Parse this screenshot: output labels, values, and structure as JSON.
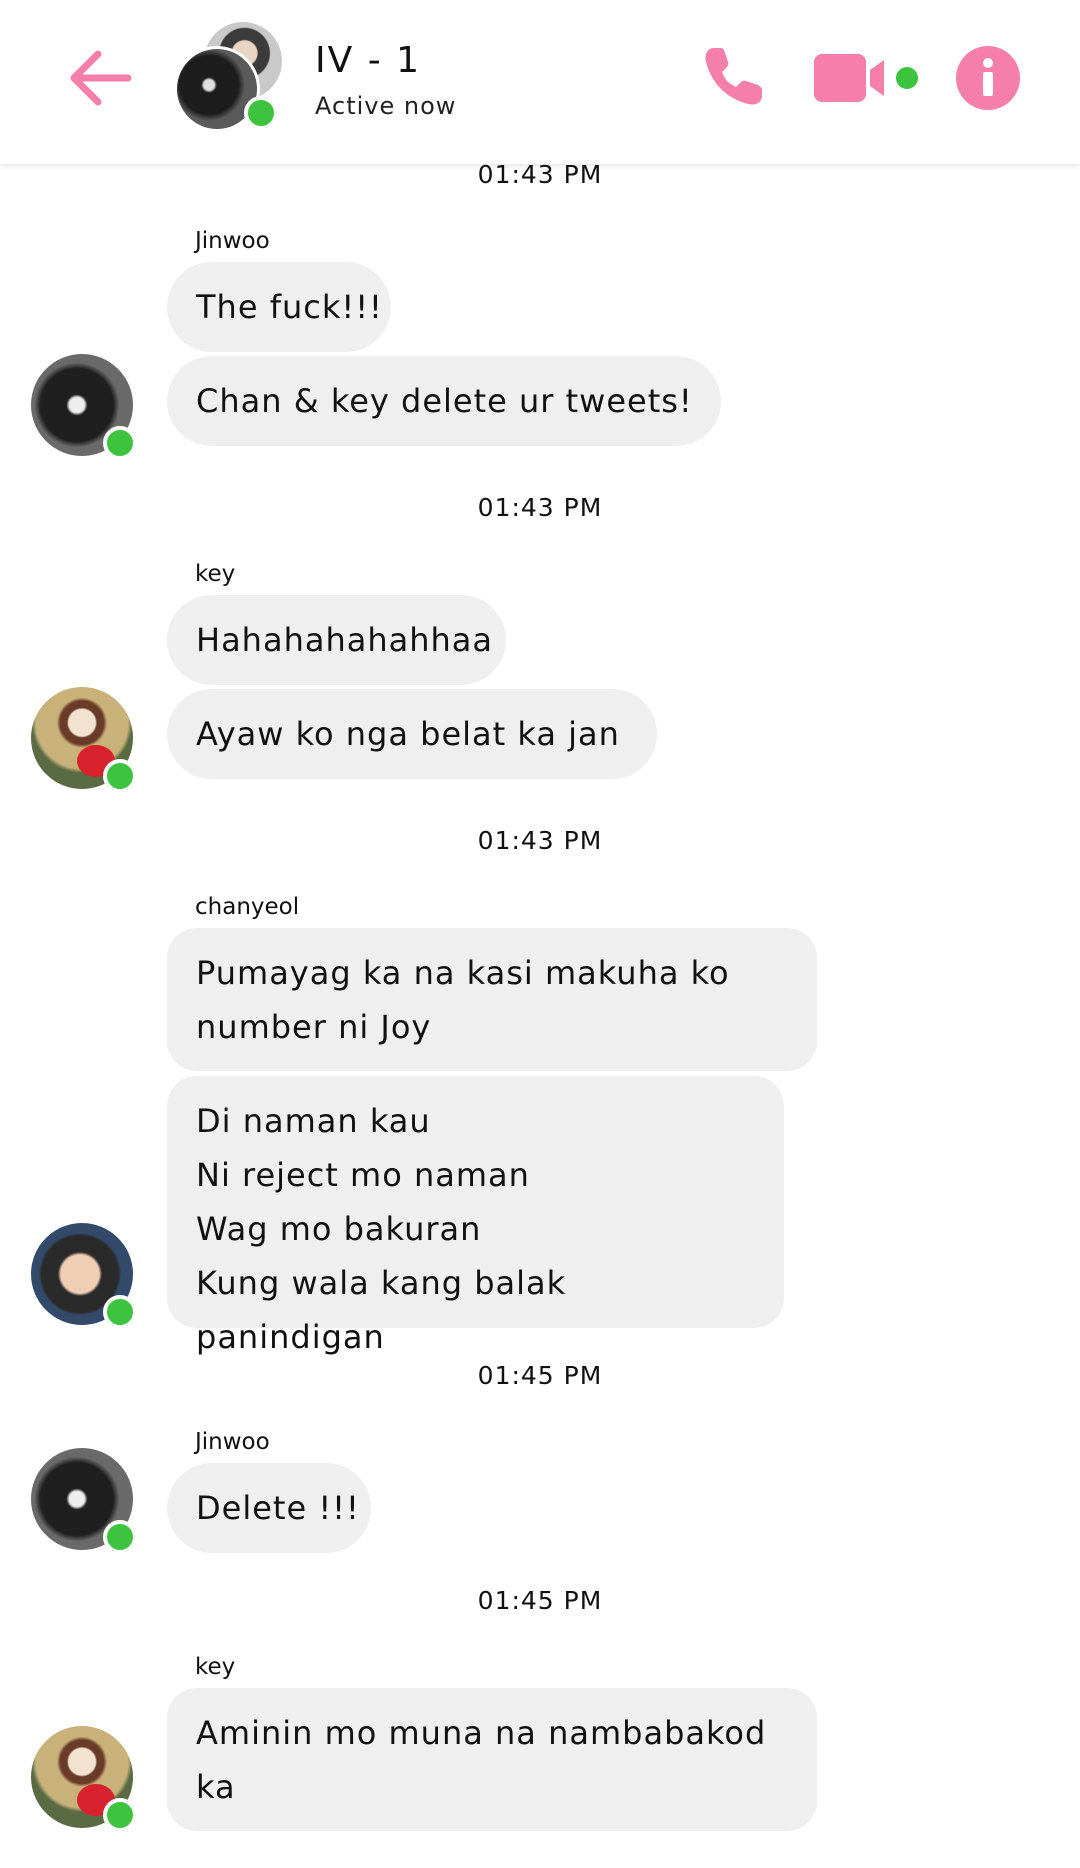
{
  "header": {
    "title": "IV - 1",
    "status": "Active now",
    "accent_color": "#f57eaa",
    "online_color": "#3ec33e",
    "icons": [
      "back-arrow-icon",
      "phone-icon",
      "video-camera-icon",
      "info-icon"
    ]
  },
  "messages": [
    {
      "time": "01:43 PM",
      "sender": "Jinwoo",
      "bubbles": [
        "The fuck!!!",
        "Chan & key delete ur tweets!"
      ]
    },
    {
      "time": "01:43 PM",
      "sender": "key",
      "bubbles": [
        "Hahahahahahhaa",
        "Ayaw ko nga belat ka jan"
      ]
    },
    {
      "time": "01:43 PM",
      "sender": "chanyeol",
      "bubbles": [
        "Pumayag ka na kasi makuha ko\nnumber ni Joy",
        "Di naman kau\nNi reject mo naman\nWag mo bakuran\nKung wala kang balak panindigan"
      ]
    },
    {
      "time": "01:45 PM",
      "sender": "Jinwoo",
      "bubbles": [
        "Delete !!!"
      ]
    },
    {
      "time": "01:45 PM",
      "sender": "key",
      "bubbles": [
        "Aminin mo muna na nambabakod\nka"
      ]
    }
  ]
}
